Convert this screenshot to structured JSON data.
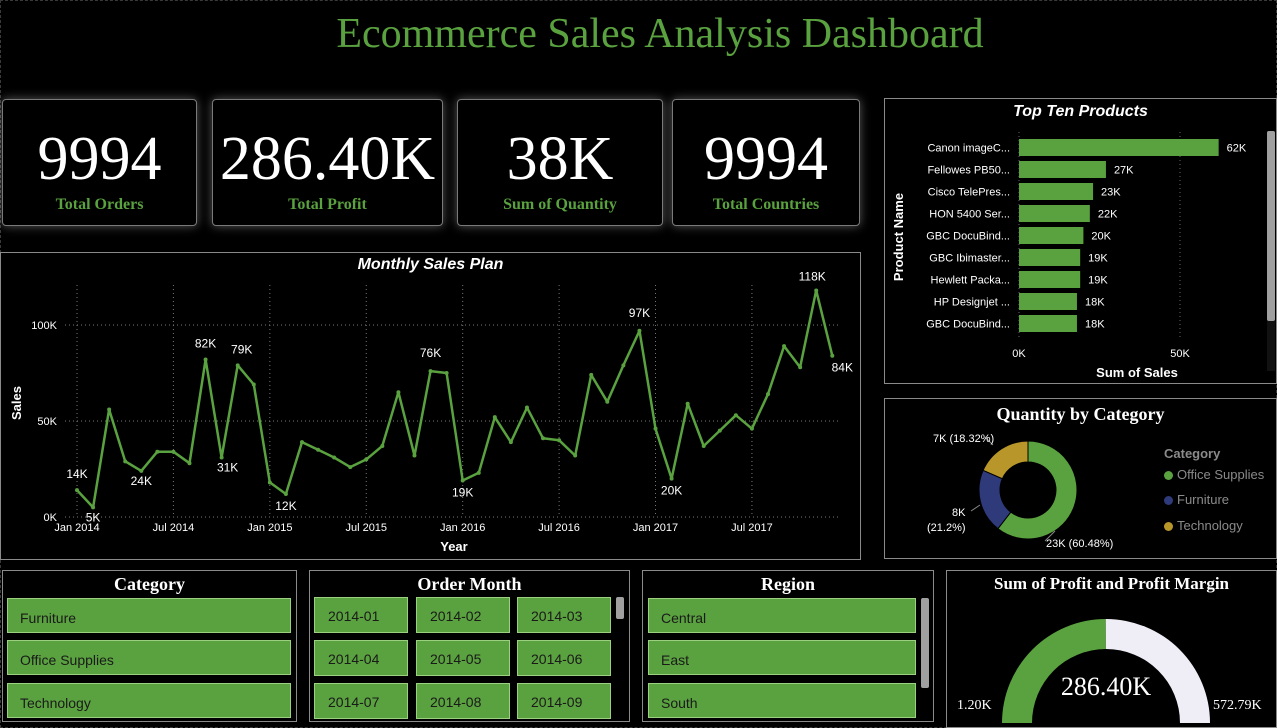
{
  "title": "Ecommerce Sales Analysis Dashboard",
  "cards": [
    {
      "value": "9994",
      "label": "Total Orders"
    },
    {
      "value": "286.40K",
      "label": "Total Profit"
    },
    {
      "value": "38K",
      "label": "Sum of Quantity"
    },
    {
      "value": "9994",
      "label": "Total Countries"
    }
  ],
  "colors": {
    "accent": "#5aa23f",
    "furniture": "#2e3a7a",
    "technology": "#b8962a",
    "gauge_rest": "#efeef7"
  },
  "monthly": {
    "title": "Monthly Sales Plan",
    "xlabel": "Year",
    "ylabel": "Sales",
    "x_ticks": [
      "Jan 2014",
      "Jul 2014",
      "Jan 2015",
      "Jul 2015",
      "Jan 2016",
      "Jul 2016",
      "Jan 2017",
      "Jul 2017"
    ],
    "y_ticks": [
      "0K",
      "50K",
      "100K"
    ]
  },
  "top_products": {
    "title": "Top Ten Products",
    "xlabel": "Sum of Sales",
    "ylabel": "Product Name",
    "x_ticks": [
      "0K",
      "50K"
    ]
  },
  "quantity": {
    "title": "Quantity by Category",
    "legend_title": "Category",
    "legend": [
      "Office Supplies",
      "Furniture",
      "Technology"
    ],
    "labels": [
      "7K (18.32%)",
      "8K",
      "(21.2%)",
      "23K (60.48%)"
    ]
  },
  "slicers": {
    "category": {
      "title": "Category",
      "items": [
        "Furniture",
        "Office Supplies",
        "Technology"
      ]
    },
    "order_month": {
      "title": "Order Month",
      "items": [
        "2014-01",
        "2014-02",
        "2014-03",
        "2014-04",
        "2014-05",
        "2014-06",
        "2014-07",
        "2014-08",
        "2014-09"
      ]
    },
    "region": {
      "title": "Region",
      "items": [
        "Central",
        "East",
        "South"
      ]
    }
  },
  "gauge": {
    "title": "Sum of Profit and Profit Margin",
    "value": "286.40K",
    "min": "1.20K",
    "max": "572.79K"
  },
  "chart_data": [
    {
      "type": "line",
      "title": "Monthly Sales Plan",
      "xlabel": "Year",
      "ylabel": "Sales",
      "ylim": [
        0,
        120000
      ],
      "x": [
        "2014-01",
        "2014-02",
        "2014-03",
        "2014-04",
        "2014-05",
        "2014-06",
        "2014-07",
        "2014-08",
        "2014-09",
        "2014-10",
        "2014-11",
        "2014-12",
        "2015-01",
        "2015-02",
        "2015-03",
        "2015-04",
        "2015-05",
        "2015-06",
        "2015-07",
        "2015-08",
        "2015-09",
        "2015-10",
        "2015-11",
        "2015-12",
        "2016-01",
        "2016-02",
        "2016-03",
        "2016-04",
        "2016-05",
        "2016-06",
        "2016-07",
        "2016-08",
        "2016-09",
        "2016-10",
        "2016-11",
        "2016-12",
        "2017-01",
        "2017-02",
        "2017-03",
        "2017-04",
        "2017-05",
        "2017-06",
        "2017-07",
        "2017-08",
        "2017-09",
        "2017-10",
        "2017-11",
        "2017-12"
      ],
      "series": [
        {
          "values": [
            14000,
            5000,
            56000,
            29000,
            24000,
            34000,
            34000,
            28000,
            82000,
            31000,
            79000,
            69000,
            18000,
            12000,
            39000,
            35000,
            31000,
            26000,
            30000,
            37000,
            65000,
            32000,
            76000,
            75000,
            19000,
            23000,
            52000,
            39000,
            57000,
            41000,
            40000,
            32000,
            74000,
            60000,
            79000,
            97000,
            46000,
            20000,
            59000,
            37000,
            45000,
            53000,
            46000,
            64000,
            89000,
            78000,
            118000,
            84000
          ]
        }
      ],
      "point_labels": [
        {
          "index": 0,
          "text": "14K"
        },
        {
          "index": 1,
          "text": "5K"
        },
        {
          "index": 4,
          "text": "24K"
        },
        {
          "index": 8,
          "text": "82K"
        },
        {
          "index": 9,
          "text": "31K"
        },
        {
          "index": 10,
          "text": "79K"
        },
        {
          "index": 13,
          "text": "12K"
        },
        {
          "index": 22,
          "text": "76K"
        },
        {
          "index": 24,
          "text": "19K"
        },
        {
          "index": 35,
          "text": "97K"
        },
        {
          "index": 37,
          "text": "20K"
        },
        {
          "index": 46,
          "text": "118K"
        },
        {
          "index": 47,
          "text": "84K"
        }
      ]
    },
    {
      "type": "bar",
      "title": "Top Ten Products",
      "xlabel": "Sum of Sales",
      "ylabel": "Product Name",
      "xlim": [
        0,
        75000
      ],
      "categories": [
        "Canon imageC...",
        "Fellowes PB50...",
        "Cisco TelePres...",
        "HON 5400 Ser...",
        "GBC DocuBind...",
        "GBC Ibimaster...",
        "Hewlett Packa...",
        "HP Designjet ...",
        "GBC DocuBind..."
      ],
      "values": [
        62000,
        27000,
        23000,
        22000,
        20000,
        19000,
        19000,
        18000,
        18000
      ],
      "labels": [
        "62K",
        "27K",
        "23K",
        "22K",
        "20K",
        "19K",
        "19K",
        "18K",
        "18K"
      ]
    },
    {
      "type": "pie",
      "title": "Quantity by Category",
      "categories": [
        "Office Supplies",
        "Furniture",
        "Technology"
      ],
      "values": [
        23000,
        8000,
        7000
      ],
      "percent": [
        60.48,
        21.2,
        18.32
      ]
    },
    {
      "type": "gauge",
      "title": "Sum of Profit and Profit Margin",
      "value": 286400,
      "min": 1200,
      "max": 572790
    }
  ]
}
